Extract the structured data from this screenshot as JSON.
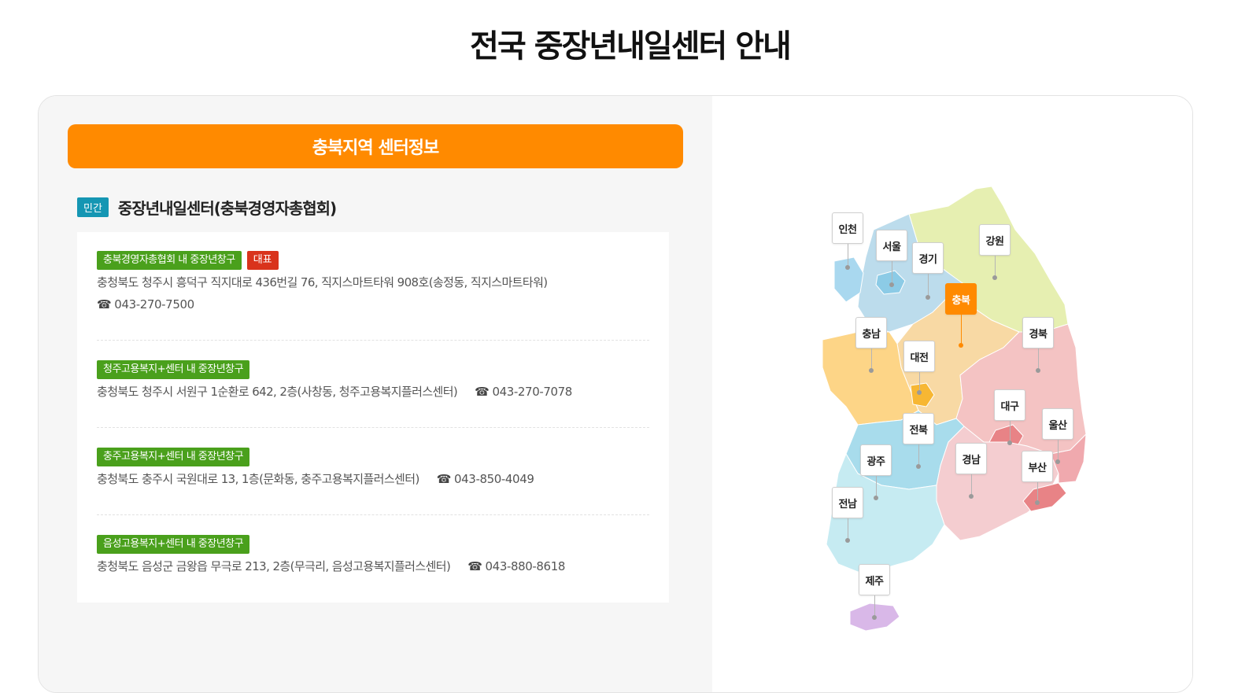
{
  "page": {
    "title": "전국 중장년내일센터 안내"
  },
  "region": {
    "header": "충북지역 센터정보"
  },
  "center": {
    "type_badge": "민간",
    "name": "중장년내일센터(충북경영자총협회)"
  },
  "branches": [
    {
      "name": "충북경영자총협회 내 중장년창구",
      "badge": "대표",
      "address": "충청북도 청주시 흥덕구 직지대로 436번길 76, 직지스마트타워 908호(송정동, 직지스마트타워)",
      "phone": "043-270-7500"
    },
    {
      "name": "청주고용복지+센터 내 중장년창구",
      "address": "충청북도 청주시 서원구 1순환로 642, 2층(사창동, 청주고용복지플러스센터)",
      "phone": "043-270-7078"
    },
    {
      "name": "충주고용복지+센터 내 중장년창구",
      "address": "충청북도 충주시 국원대로 13, 1층(문화동, 충주고용복지플러스센터)",
      "phone": "043-850-4049"
    },
    {
      "name": "음성고용복지+센터 내 중장년창구",
      "address": "충청북도 음성군 금왕읍 무극로 213, 2층(무극리, 음성고용복지플러스센터)",
      "phone": "043-880-8618"
    }
  ],
  "icons": {
    "phone": "telephone-icon"
  },
  "phone_glyph": "☎",
  "map": {
    "selected": "충북",
    "regions": {
      "incheon": "인천",
      "seoul": "서울",
      "gyeonggi": "경기",
      "gangwon": "강원",
      "chungbuk": "충북",
      "chungnam": "충남",
      "daejeon": "대전",
      "gyeongbuk": "경북",
      "daegu": "대구",
      "ulsan": "울산",
      "jeonbuk": "전북",
      "gwangju": "광주",
      "gyeongnam": "경남",
      "busan": "부산",
      "jeonnam": "전남",
      "jeju": "제주"
    }
  },
  "colors": {
    "accent": "#ff8a00",
    "badge_private": "#1596b3",
    "tag_branch": "#4aa01c",
    "tag_main": "#d9331c"
  }
}
